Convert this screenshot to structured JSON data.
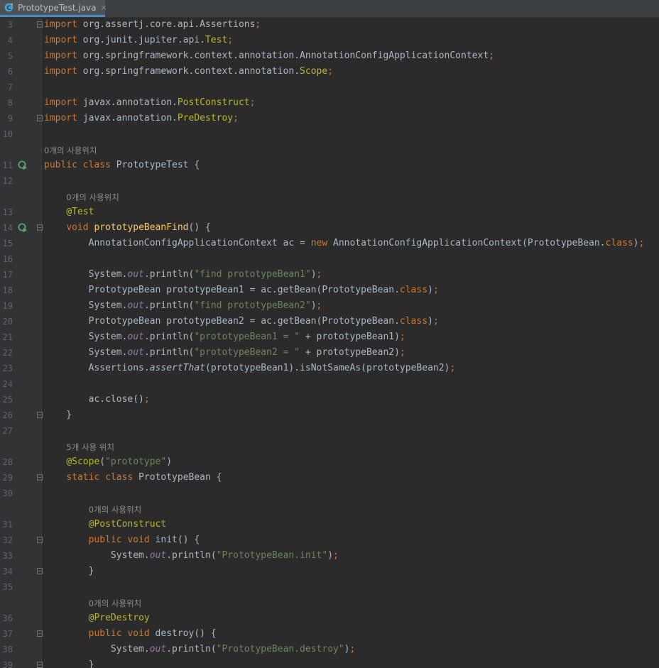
{
  "tab": {
    "filename": "PrototypeTest.java",
    "close": "×"
  },
  "lines": [
    {
      "n": "3",
      "hint": "",
      "segs": [
        [
          "kw",
          "import"
        ],
        [
          "p",
          " org.assertj.core.api.Assertions"
        ],
        [
          "kw",
          ";"
        ]
      ]
    },
    {
      "n": "4",
      "hint": "",
      "segs": [
        [
          "kw",
          "import"
        ],
        [
          "p",
          " org.junit.jupiter.api."
        ],
        [
          "ann",
          "Test"
        ],
        [
          "kw",
          ";"
        ]
      ]
    },
    {
      "n": "5",
      "hint": "",
      "segs": [
        [
          "kw",
          "import"
        ],
        [
          "p",
          " org.springframework.context.annotation.AnnotationConfigApplicationContext"
        ],
        [
          "kw",
          ";"
        ]
      ]
    },
    {
      "n": "6",
      "hint": "",
      "segs": [
        [
          "kw",
          "import"
        ],
        [
          "p",
          " org.springframework.context.annotation."
        ],
        [
          "ann",
          "Scope"
        ],
        [
          "kw",
          ";"
        ]
      ]
    },
    {
      "n": "7",
      "hint": "",
      "segs": []
    },
    {
      "n": "8",
      "hint": "",
      "segs": [
        [
          "kw",
          "import"
        ],
        [
          "p",
          " javax.annotation."
        ],
        [
          "ann",
          "PostConstruct"
        ],
        [
          "kw",
          ";"
        ]
      ]
    },
    {
      "n": "9",
      "hint": "",
      "segs": [
        [
          "kw",
          "import"
        ],
        [
          "p",
          " javax.annotation."
        ],
        [
          "ann",
          "PreDestroy"
        ],
        [
          "kw",
          ";"
        ]
      ]
    },
    {
      "n": "10",
      "hint": "",
      "segs": []
    },
    {
      "n": "11",
      "hint": "0개의 사용위치",
      "segs": [
        [
          "kw",
          "public class"
        ],
        [
          "p",
          " PrototypeTest {"
        ]
      ]
    },
    {
      "n": "12",
      "hint": "",
      "segs": []
    },
    {
      "n": "13",
      "hint": "0개의 사용위치",
      "segs": [
        [
          "p",
          "    "
        ],
        [
          "ann",
          "@Test"
        ]
      ]
    },
    {
      "n": "14",
      "hint": "",
      "segs": [
        [
          "p",
          "    "
        ],
        [
          "kw",
          "void"
        ],
        [
          "p",
          " "
        ],
        [
          "fn",
          "prototypeBeanFind"
        ],
        [
          "p",
          "() {"
        ]
      ]
    },
    {
      "n": "15",
      "hint": "",
      "segs": [
        [
          "p",
          "        AnnotationConfigApplicationContext ac = "
        ],
        [
          "kw",
          "new"
        ],
        [
          "p",
          " AnnotationConfigApplicationContext(PrototypeBean."
        ],
        [
          "kw",
          "class"
        ],
        [
          "p",
          ")"
        ],
        [
          "kw",
          ";"
        ]
      ]
    },
    {
      "n": "16",
      "hint": "",
      "segs": []
    },
    {
      "n": "17",
      "hint": "",
      "segs": [
        [
          "p",
          "        System."
        ],
        [
          "fld",
          "out"
        ],
        [
          "p",
          ".println("
        ],
        [
          "str",
          "\"find prototypeBean1\""
        ],
        [
          "p",
          ")"
        ],
        [
          "kw",
          ";"
        ]
      ]
    },
    {
      "n": "18",
      "hint": "",
      "segs": [
        [
          "p",
          "        PrototypeBean prototypeBean1 = ac.getBean(PrototypeBean."
        ],
        [
          "kw",
          "class"
        ],
        [
          "p",
          ")"
        ],
        [
          "kw",
          ";"
        ]
      ]
    },
    {
      "n": "19",
      "hint": "",
      "segs": [
        [
          "p",
          "        System."
        ],
        [
          "fld",
          "out"
        ],
        [
          "p",
          ".println("
        ],
        [
          "str",
          "\"find prototypeBean2\""
        ],
        [
          "p",
          ")"
        ],
        [
          "kw",
          ";"
        ]
      ]
    },
    {
      "n": "20",
      "hint": "",
      "segs": [
        [
          "p",
          "        PrototypeBean prototypeBean2 = ac.getBean(PrototypeBean."
        ],
        [
          "kw",
          "class"
        ],
        [
          "p",
          ")"
        ],
        [
          "kw",
          ";"
        ]
      ]
    },
    {
      "n": "21",
      "hint": "",
      "segs": [
        [
          "p",
          "        System."
        ],
        [
          "fld",
          "out"
        ],
        [
          "p",
          ".println("
        ],
        [
          "str",
          "\"prototypeBean1 = \""
        ],
        [
          "p",
          " + prototypeBean1)"
        ],
        [
          "kw",
          ";"
        ]
      ]
    },
    {
      "n": "22",
      "hint": "",
      "segs": [
        [
          "p",
          "        System."
        ],
        [
          "fld",
          "out"
        ],
        [
          "p",
          ".println("
        ],
        [
          "str",
          "\"prototypeBean2 = \""
        ],
        [
          "p",
          " + prototypeBean2)"
        ],
        [
          "kw",
          ";"
        ]
      ]
    },
    {
      "n": "23",
      "hint": "",
      "segs": [
        [
          "p",
          "        Assertions."
        ],
        [
          "st",
          "assertThat"
        ],
        [
          "p",
          "(prototypeBean1).isNotSameAs(prototypeBean2)"
        ],
        [
          "kw",
          ";"
        ]
      ]
    },
    {
      "n": "24",
      "hint": "",
      "segs": []
    },
    {
      "n": "25",
      "hint": "",
      "segs": [
        [
          "p",
          "        ac.close()"
        ],
        [
          "kw",
          ";"
        ]
      ]
    },
    {
      "n": "26",
      "hint": "",
      "segs": [
        [
          "p",
          "    }"
        ]
      ]
    },
    {
      "n": "27",
      "hint": "",
      "segs": []
    },
    {
      "n": "28",
      "hint": "5개 사용 위치",
      "segs": [
        [
          "p",
          "    "
        ],
        [
          "ann",
          "@Scope"
        ],
        [
          "p",
          "("
        ],
        [
          "str",
          "\"prototype\""
        ],
        [
          "p",
          ")"
        ]
      ]
    },
    {
      "n": "29",
      "hint": "",
      "segs": [
        [
          "p",
          "    "
        ],
        [
          "kw",
          "static class"
        ],
        [
          "p",
          " PrototypeBean {"
        ]
      ]
    },
    {
      "n": "30",
      "hint": "",
      "segs": []
    },
    {
      "n": "31",
      "hint": "0개의 사용위치",
      "segs": [
        [
          "p",
          "        "
        ],
        [
          "ann",
          "@PostConstruct"
        ]
      ]
    },
    {
      "n": "32",
      "hint": "",
      "segs": [
        [
          "p",
          "        "
        ],
        [
          "kw",
          "public void"
        ],
        [
          "p",
          " init() {"
        ]
      ]
    },
    {
      "n": "33",
      "hint": "",
      "segs": [
        [
          "p",
          "            System."
        ],
        [
          "fld",
          "out"
        ],
        [
          "p",
          ".println("
        ],
        [
          "str",
          "\"PrototypeBean.init\""
        ],
        [
          "p",
          ")"
        ],
        [
          "kw",
          ";"
        ]
      ]
    },
    {
      "n": "34",
      "hint": "",
      "segs": [
        [
          "p",
          "        }"
        ]
      ]
    },
    {
      "n": "35",
      "hint": "",
      "segs": []
    },
    {
      "n": "36",
      "hint": "0개의 사용위치",
      "segs": [
        [
          "p",
          "        "
        ],
        [
          "ann",
          "@PreDestroy"
        ]
      ]
    },
    {
      "n": "37",
      "hint": "",
      "segs": [
        [
          "p",
          "        "
        ],
        [
          "kw",
          "public void"
        ],
        [
          "p",
          " destroy() {"
        ]
      ]
    },
    {
      "n": "38",
      "hint": "",
      "segs": [
        [
          "p",
          "            System."
        ],
        [
          "fld",
          "out"
        ],
        [
          "p",
          ".println("
        ],
        [
          "str",
          "\"PrototypeBean.destroy\""
        ],
        [
          "p",
          ")"
        ],
        [
          "kw",
          ";"
        ]
      ]
    },
    {
      "n": "39",
      "hint": "",
      "segs": [
        [
          "p",
          "        }"
        ]
      ]
    }
  ],
  "run_lines": [
    "11",
    "14"
  ],
  "fold_lines": [
    "3",
    "9",
    "14",
    "26",
    "29",
    "32",
    "34",
    "37",
    "39"
  ]
}
